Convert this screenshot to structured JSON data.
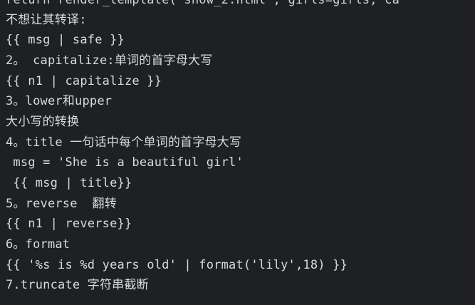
{
  "editor": {
    "lines": [
      "return render_template('show_2.html', girls=girls, ca",
      "不想让其转译:",
      "{{ msg | safe }}",
      "2。 capitalize:单词的首字母大写",
      "{{ n1 | capitalize }}",
      "3。lower和upper",
      "大小写的转换",
      "4。title 一句话中每个单词的首字母大写",
      " msg = 'She is a beautiful girl'",
      " {{ msg | title}}",
      "5。reverse  翻转",
      "{{ n1 | reverse}}",
      "6。format",
      "{{ '%s is %d years old' | format('lily',18) }}",
      "7.truncate 字符串截断"
    ]
  }
}
